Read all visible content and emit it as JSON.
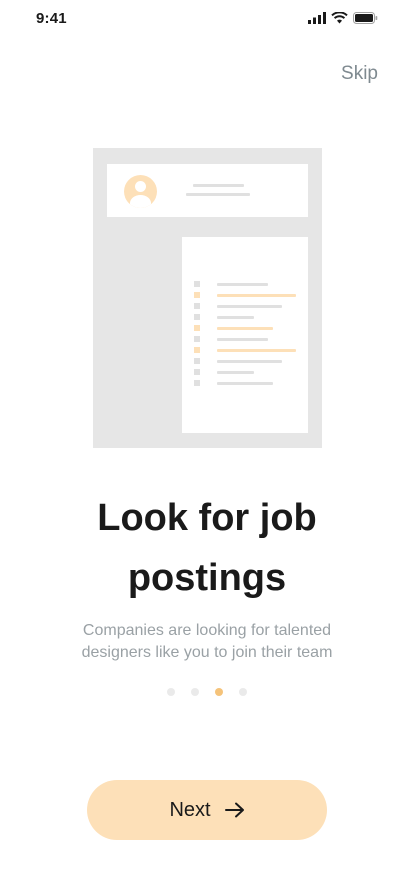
{
  "status_bar": {
    "time": "9:41"
  },
  "header": {
    "skip_label": "Skip"
  },
  "onboarding": {
    "title_line1": "Look for job",
    "title_line2": "postings",
    "description_line1": "Companies are looking for talented",
    "description_line2": "designers like you to join their team",
    "page_count": 4,
    "active_page": 3
  },
  "footer": {
    "next_label": "Next"
  },
  "colors": {
    "accent": "#fde0b8",
    "accent_strong": "#f5c37a",
    "illustration_bg": "#e6e6e6",
    "muted_text": "#9aa1a5"
  }
}
